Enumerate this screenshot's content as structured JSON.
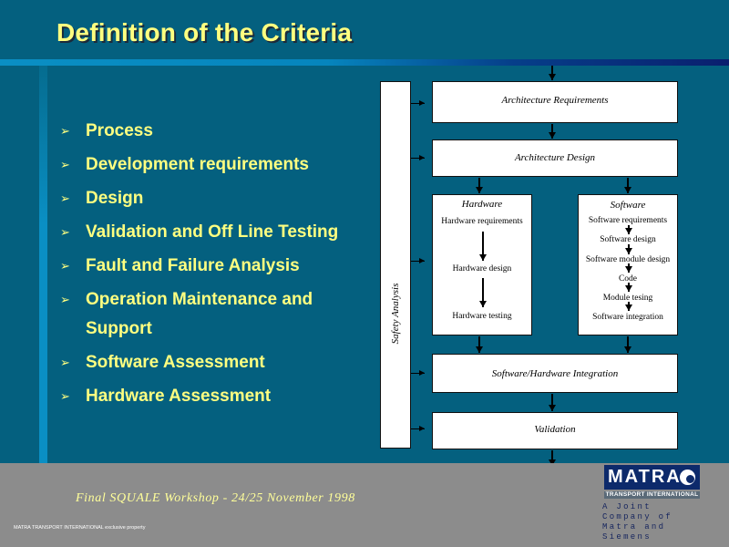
{
  "slide": {
    "title": "Definition of the Criteria",
    "colors": {
      "background": "#04607f",
      "title_text": "#ffff80",
      "accent_rule": "#0a8fc4",
      "footer": "#8c8c8c",
      "logo_navy": "#0d2a6b"
    }
  },
  "bullets": {
    "marker_icon": "chevron-right-icon",
    "marker_glyph": "➢",
    "items": [
      {
        "label": "Process"
      },
      {
        "label": "Development requirements"
      },
      {
        "label": "Design"
      },
      {
        "label": "Validation and Off Line Testing"
      },
      {
        "label": "Fault and Failure Analysis"
      },
      {
        "label": "Operation Maintenance and Support",
        "line1": "Operation Maintenance and",
        "line2": "Support"
      },
      {
        "label": "Software Assessment"
      },
      {
        "label": "Hardware Assessment"
      }
    ]
  },
  "diagram": {
    "safety_analysis": "Safety Analysis",
    "architecture_requirements": "Architecture Requirements",
    "architecture_design": "Architecture Design",
    "hardware": {
      "heading": "Hardware",
      "steps": [
        "Hardware requirements",
        "Hardware design",
        "Hardware testing"
      ]
    },
    "software": {
      "heading": "Software",
      "steps": [
        "Software requirements",
        "Software design",
        "Software module design",
        "Code",
        "Module tesing",
        "Software integration"
      ]
    },
    "integration": "Software/Hardware Integration",
    "validation": "Validation"
  },
  "footer": {
    "workshop": "Final SQUALE Workshop - 24/25 November 1998",
    "copyright": "MATRA TRANSPORT INTERNATIONAL exclusive property",
    "logo": {
      "name": "MATRA",
      "subtitle": "TRANSPORT INTERNATIONAL",
      "tagline_line1": "A Joint Company of",
      "tagline_line2": "Matra and Siemens"
    }
  }
}
